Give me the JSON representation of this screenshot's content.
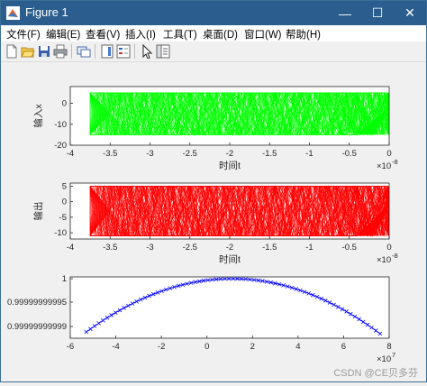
{
  "window": {
    "title": "Figure 1",
    "controls": {
      "minimize": "—",
      "maximize": "☐",
      "close": "✕"
    }
  },
  "menu": [
    "文件(F)",
    "编辑(E)",
    "查看(V)",
    "插入(I)",
    "工具(T)",
    "桌面(D)",
    "窗口(W)",
    "帮助(H)"
  ],
  "toolbar_icons": [
    "new-figure-icon",
    "open-file-icon",
    "save-icon",
    "print-icon",
    "link-plot-icon",
    "colorbar-icon",
    "legend-icon",
    "edit-plot-icon",
    "property-inspector-icon"
  ],
  "watermark": "CSDN @CE贝多芬",
  "colors": {
    "plot1": "#00ff00",
    "plot2": "#ff0000",
    "plot3": "#0000ff",
    "titlebar": "#2b5e8e"
  },
  "chart_data": [
    {
      "type": "line",
      "series_color": "#00ff00",
      "xlabel": "时间t",
      "ylabel": "输入x",
      "xlim": [
        -4e-08,
        0
      ],
      "ylim": [
        -20,
        8
      ],
      "xticks": [
        "-4",
        "-3.5",
        "-3",
        "-2.5",
        "-2",
        "-1.5",
        "-1",
        "-0.5",
        "0"
      ],
      "yticks": [
        "-20",
        "-10",
        "0"
      ],
      "x_exponent": "×10",
      "x_exponent_power": "-8",
      "data_band": {
        "x_range": [
          -3.75e-08,
          0
        ],
        "y_min": -15,
        "y_max": 5
      }
    },
    {
      "type": "line",
      "series_color": "#ff0000",
      "xlabel": "时间t",
      "ylabel": "输出",
      "xlim": [
        -4e-08,
        0
      ],
      "ylim": [
        -12,
        6
      ],
      "xticks": [
        "-4",
        "-3.5",
        "-3",
        "-2.5",
        "-2",
        "-1.5",
        "-1",
        "-0.5",
        "0"
      ],
      "yticks": [
        "-10",
        "-5",
        "0",
        "5"
      ],
      "x_exponent": "×10",
      "x_exponent_power": "-8",
      "data_band": {
        "x_range": [
          -3.75e-08,
          0
        ],
        "y_min": -11,
        "y_max": 5
      }
    },
    {
      "type": "line",
      "series_color": "#0000ff",
      "marker": "x",
      "xlim": [
        -60000000.0,
        80000000.0
      ],
      "ylim": [
        0.99999999998,
        1
      ],
      "xticks": [
        "-6",
        "-4",
        "-2",
        "0",
        "2",
        "4",
        "6",
        "8"
      ],
      "yticks": [
        "1",
        "0.99999999995",
        "0.99999999999"
      ],
      "x_exponent": "×10",
      "x_exponent_power": "7",
      "curve": {
        "x_start": -53000000.0,
        "x_end": 76000000.0,
        "x_peak": 11000000.0
      }
    }
  ]
}
